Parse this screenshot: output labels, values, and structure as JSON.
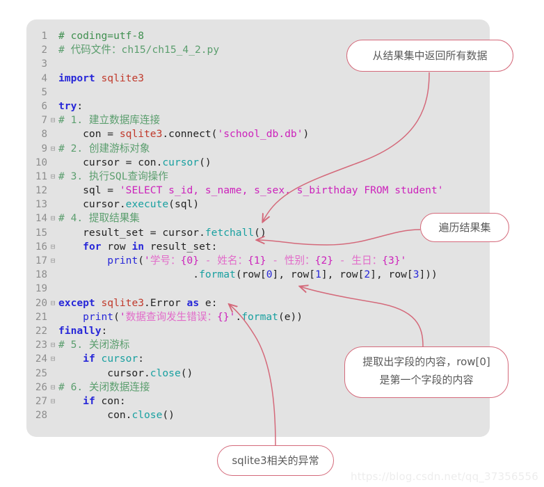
{
  "code_block": {
    "language": "python",
    "background_color": "#e3e3e3",
    "lines": [
      {
        "no": "1",
        "fold": false,
        "tokens": [
          {
            "t": "# coding=utf-8",
            "c": "c-comment"
          }
        ]
      },
      {
        "no": "2",
        "fold": false,
        "tokens": [
          {
            "t": "# 代码文件：ch15/ch15_4_2.py",
            "c": "c-comment-c"
          }
        ]
      },
      {
        "no": "3",
        "fold": false,
        "tokens": []
      },
      {
        "no": "4",
        "fold": false,
        "tokens": [
          {
            "t": "import ",
            "c": "c-kw"
          },
          {
            "t": "sqlite3",
            "c": "c-cls"
          }
        ]
      },
      {
        "no": "5",
        "fold": false,
        "tokens": []
      },
      {
        "no": "6",
        "fold": false,
        "tokens": [
          {
            "t": "try",
            "c": "c-kw"
          },
          {
            "t": ":",
            "c": "c-plain"
          }
        ]
      },
      {
        "no": "7",
        "fold": true,
        "tokens": [
          {
            "t": "# 1. 建立数据库连接",
            "c": "c-comment-c"
          }
        ]
      },
      {
        "no": "8",
        "fold": false,
        "tokens": [
          {
            "t": "    con = ",
            "c": "c-plain"
          },
          {
            "t": "sqlite3",
            "c": "c-cls"
          },
          {
            "t": ".connect(",
            "c": "c-plain"
          },
          {
            "t": "'school_db.db'",
            "c": "c-str"
          },
          {
            "t": ")",
            "c": "c-plain"
          }
        ]
      },
      {
        "no": "9",
        "fold": true,
        "tokens": [
          {
            "t": "# 2. 创建游标对象",
            "c": "c-comment-c"
          }
        ]
      },
      {
        "no": "10",
        "fold": false,
        "tokens": [
          {
            "t": "    cursor = con.",
            "c": "c-plain"
          },
          {
            "t": "cursor",
            "c": "c-fn"
          },
          {
            "t": "()",
            "c": "c-plain"
          }
        ]
      },
      {
        "no": "11",
        "fold": true,
        "tokens": [
          {
            "t": "# 3. 执行SQL查询操作",
            "c": "c-comment-c"
          }
        ]
      },
      {
        "no": "12",
        "fold": false,
        "tokens": [
          {
            "t": "    sql = ",
            "c": "c-plain"
          },
          {
            "t": "'SELECT s_id, s_name, s_sex, s_birthday FROM student'",
            "c": "c-str"
          }
        ]
      },
      {
        "no": "13",
        "fold": false,
        "tokens": [
          {
            "t": "    cursor.",
            "c": "c-plain"
          },
          {
            "t": "execute",
            "c": "c-fn"
          },
          {
            "t": "(sql)",
            "c": "c-plain"
          }
        ]
      },
      {
        "no": "14",
        "fold": true,
        "tokens": [
          {
            "t": "# 4. 提取结果集",
            "c": "c-comment-c"
          }
        ]
      },
      {
        "no": "15",
        "fold": false,
        "tokens": [
          {
            "t": "    result_set = cursor.",
            "c": "c-plain"
          },
          {
            "t": "fetchall",
            "c": "c-fn"
          },
          {
            "t": "()",
            "c": "c-plain"
          }
        ]
      },
      {
        "no": "16",
        "fold": true,
        "tokens": [
          {
            "t": "    ",
            "c": "c-plain"
          },
          {
            "t": "for",
            "c": "c-kw"
          },
          {
            "t": " row ",
            "c": "c-plain"
          },
          {
            "t": "in",
            "c": "c-kw"
          },
          {
            "t": " result_set:",
            "c": "c-plain"
          }
        ]
      },
      {
        "no": "17",
        "fold": true,
        "tokens": [
          {
            "t": "        ",
            "c": "c-plain"
          },
          {
            "t": "print",
            "c": "c-builtin"
          },
          {
            "t": "(",
            "c": "c-plain"
          },
          {
            "t": "'",
            "c": "c-str"
          },
          {
            "t": "学号：",
            "c": "c-str-cjk"
          },
          {
            "t": "{0}",
            "c": "c-str"
          },
          {
            "t": " - ",
            "c": "c-str-cjk"
          },
          {
            "t": "姓名：",
            "c": "c-str-cjk"
          },
          {
            "t": "{1}",
            "c": "c-str"
          },
          {
            "t": " - ",
            "c": "c-str-cjk"
          },
          {
            "t": "性别：",
            "c": "c-str-cjk"
          },
          {
            "t": "{2}",
            "c": "c-str"
          },
          {
            "t": " - ",
            "c": "c-str-cjk"
          },
          {
            "t": "生日：",
            "c": "c-str-cjk"
          },
          {
            "t": "{3}",
            "c": "c-str"
          },
          {
            "t": "'",
            "c": "c-str"
          }
        ]
      },
      {
        "no": "18",
        "fold": false,
        "tokens": [
          {
            "t": "                      .",
            "c": "c-plain"
          },
          {
            "t": "format",
            "c": "c-fn"
          },
          {
            "t": "(row[",
            "c": "c-plain"
          },
          {
            "t": "0",
            "c": "c-num"
          },
          {
            "t": "], row[",
            "c": "c-plain"
          },
          {
            "t": "1",
            "c": "c-num"
          },
          {
            "t": "], row[",
            "c": "c-plain"
          },
          {
            "t": "2",
            "c": "c-num"
          },
          {
            "t": "], row[",
            "c": "c-plain"
          },
          {
            "t": "3",
            "c": "c-num"
          },
          {
            "t": "]))",
            "c": "c-plain"
          }
        ]
      },
      {
        "no": "19",
        "fold": false,
        "tokens": []
      },
      {
        "no": "20",
        "fold": true,
        "tokens": [
          {
            "t": "except ",
            "c": "c-kw"
          },
          {
            "t": "sqlite3",
            "c": "c-cls"
          },
          {
            "t": ".Error ",
            "c": "c-plain"
          },
          {
            "t": "as",
            "c": "c-kw"
          },
          {
            "t": " e:",
            "c": "c-plain"
          }
        ]
      },
      {
        "no": "21",
        "fold": false,
        "tokens": [
          {
            "t": "    ",
            "c": "c-plain"
          },
          {
            "t": "print",
            "c": "c-builtin"
          },
          {
            "t": "(",
            "c": "c-plain"
          },
          {
            "t": "'",
            "c": "c-str"
          },
          {
            "t": "数据查询发生错误：",
            "c": "c-str-cjk"
          },
          {
            "t": "{}",
            "c": "c-str"
          },
          {
            "t": "'",
            "c": "c-str"
          },
          {
            "t": ".",
            "c": "c-plain"
          },
          {
            "t": "format",
            "c": "c-fn"
          },
          {
            "t": "(e))",
            "c": "c-plain"
          }
        ]
      },
      {
        "no": "22",
        "fold": false,
        "tokens": [
          {
            "t": "finally",
            "c": "c-kw"
          },
          {
            "t": ":",
            "c": "c-plain"
          }
        ]
      },
      {
        "no": "23",
        "fold": true,
        "tokens": [
          {
            "t": "# 5. 关闭游标",
            "c": "c-comment-c"
          }
        ]
      },
      {
        "no": "24",
        "fold": true,
        "tokens": [
          {
            "t": "    ",
            "c": "c-plain"
          },
          {
            "t": "if",
            "c": "c-kw"
          },
          {
            "t": " ",
            "c": "c-plain"
          },
          {
            "t": "cursor",
            "c": "c-fn"
          },
          {
            "t": ":",
            "c": "c-plain"
          }
        ]
      },
      {
        "no": "25",
        "fold": false,
        "tokens": [
          {
            "t": "        cursor.",
            "c": "c-plain"
          },
          {
            "t": "close",
            "c": "c-fn"
          },
          {
            "t": "()",
            "c": "c-plain"
          }
        ]
      },
      {
        "no": "26",
        "fold": true,
        "tokens": [
          {
            "t": "# 6. 关闭数据连接",
            "c": "c-comment-c"
          }
        ]
      },
      {
        "no": "27",
        "fold": true,
        "tokens": [
          {
            "t": "    ",
            "c": "c-plain"
          },
          {
            "t": "if",
            "c": "c-kw"
          },
          {
            "t": " con:",
            "c": "c-plain"
          }
        ]
      },
      {
        "no": "28",
        "fold": false,
        "tokens": [
          {
            "t": "        con.",
            "c": "c-plain"
          },
          {
            "t": "close",
            "c": "c-fn"
          },
          {
            "t": "()",
            "c": "c-plain"
          }
        ]
      }
    ]
  },
  "annotations": {
    "border_color": "#d4697a",
    "arrow_color": "#d4697a",
    "callouts": [
      {
        "id": "fetchall",
        "text": "从结果集中返回所有数据"
      },
      {
        "id": "iterate",
        "text": "遍历结果集"
      },
      {
        "id": "extract",
        "line1": "提取出字段的内容，row[0]",
        "line2": "是第一个字段的内容"
      },
      {
        "id": "exception",
        "text": "sqlite3相关的异常"
      }
    ]
  },
  "watermark": {
    "text": "https://blog.csdn.net/qq_37356556"
  }
}
